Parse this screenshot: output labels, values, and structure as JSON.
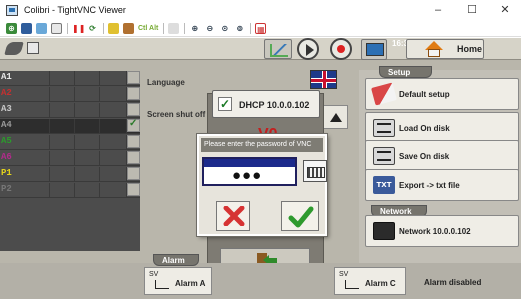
{
  "window": {
    "title": "Colibri - TightVNC Viewer",
    "controls": [
      "–",
      "☐",
      "✕"
    ]
  },
  "toolbar": {
    "ctrl_alt_del": "Ctl Alt"
  },
  "header": {
    "time": "16:35:46",
    "home_label": "Home"
  },
  "grid": {
    "rows": [
      {
        "label": "A1",
        "color": "#e6e6e6",
        "checked": false
      },
      {
        "label": "A2",
        "color": "#c43030",
        "checked": false
      },
      {
        "label": "A3",
        "color": "#c8c8c8",
        "checked": false
      },
      {
        "label": "A4",
        "color": "#111111",
        "checked": true
      },
      {
        "label": "A5",
        "color": "#2c9a2c",
        "checked": false
      },
      {
        "label": "A6",
        "color": "#b02b8a",
        "checked": false
      },
      {
        "label": "P1",
        "color": "#e3d21c",
        "checked": false
      },
      {
        "label": "P2",
        "color": "#5a5a5a",
        "checked": false
      }
    ]
  },
  "settings": {
    "language_label": "Language",
    "screen_shut_off_label": "Screen shut off :",
    "dhcp_label": "DHCP 10.0.0.102",
    "dhcp_checked": true,
    "value_text": "V0"
  },
  "setup": {
    "section_title": "Setup",
    "default_setup": "Default setup",
    "load_on_disk": "Load On disk",
    "save_on_disk": "Save On disk",
    "export_txt": "Export -> txt file",
    "txt_icon_text": "TXT"
  },
  "network": {
    "section_title": "Network",
    "network_label": "Network 10.0.0.102"
  },
  "alarm": {
    "section_title": "Alarm",
    "alarm_a_label": "Alarm A",
    "alarm_c_label": "Alarm C",
    "status_text": "Alarm disabled",
    "sv_text": "SV"
  },
  "dialog": {
    "title": "Please enter the password of VNC",
    "password_mask": "●●●"
  },
  "colors": {
    "remote_bg": "#b9b6ab",
    "dialog_titlebar": "#7e7c74",
    "cancel_red": "#d63333",
    "ok_green": "#2e9a2e"
  }
}
